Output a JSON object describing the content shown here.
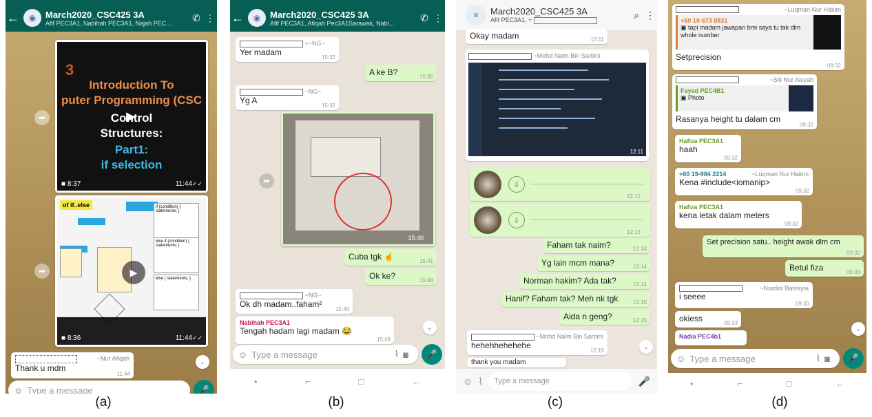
{
  "captions": [
    "(a)",
    "(b)",
    "(c)",
    "(d)"
  ],
  "panel_a": {
    "header": {
      "name": "March2020_CSC425 3A",
      "participants": "Afif PEC3A1, Nabihah PEC3A1, Najah PEC..."
    },
    "video1": {
      "slide_num": "3",
      "line1": "Introduction To",
      "line2": "puter Programming (CSC",
      "line3": "Control",
      "line4": "Structures:",
      "line5": "Part1:",
      "line6": "if selection",
      "duration": "8:37",
      "time": "11:44"
    },
    "video2": {
      "tag": "of if..else",
      "box1": "if (condition) { statements; }",
      "box2": "else if (condition) { statements; }",
      "box3": "else { statements; }",
      "duration": "8:36",
      "time": "11:44"
    },
    "msg": {
      "sender": "~Nur Afiqah",
      "text": "Thank u mdm",
      "time": "11:44"
    },
    "input_placeholder": "Type a message"
  },
  "panel_b": {
    "header": {
      "name": "March2020_CSC425 3A",
      "participants": "Afif PEC3A1, Afiqah Pec3A1Sarawak, Nabi..."
    },
    "messages": [
      {
        "sender": "+~NG~",
        "text": "Yer madam",
        "time": "15:32",
        "out": false
      },
      {
        "text": "A ke B?",
        "time": "15:32",
        "out": true
      },
      {
        "sender": "~NG~",
        "text": "Yg A",
        "time": "15:32",
        "out": false
      },
      {
        "text": "Cuba tgk",
        "time": "15:41",
        "out": true
      },
      {
        "text": "Ok ke?",
        "time": "15:48",
        "out": true
      },
      {
        "sender": "~NG~",
        "text": "Ok dh madam..faham²",
        "time": "15:49",
        "out": false
      },
      {
        "sender": "Nabihah PEC3A1",
        "text": "Tengah hadam lagi madam",
        "time": "15:49",
        "out": false
      }
    ],
    "image_time": "15:40",
    "input_placeholder": "Type a message"
  },
  "panel_c": {
    "header": {
      "name": "March2020_CSC425 3A",
      "participants": "Afif PEC3A1, +"
    },
    "messages": [
      {
        "text": "Okay madam",
        "time": "12:11",
        "out": false
      },
      {
        "sender": "~Mohd Naim Bin Sarbini",
        "time": "12:11",
        "out": false
      },
      {
        "text": "Faham tak naim?",
        "time": "12:14",
        "out": true
      },
      {
        "text": "Yg lain mcm mana?",
        "time": "12:14",
        "out": true
      },
      {
        "text": "Norman hakim? Ada tak?",
        "time": "12:14",
        "out": true
      },
      {
        "text": "Hanif? Faham tak? Meh nk tgk",
        "time": "12:15",
        "out": true
      },
      {
        "text": "Aida n geng?",
        "time": "12:15",
        "out": true
      },
      {
        "sender": "~Mohd Naim Bin Sarbini",
        "text": "hehehhehehehe",
        "time": "12:15",
        "out": false
      },
      {
        "text": "thank you madam",
        "time": "",
        "out": false
      }
    ],
    "voice_times": [
      "12:12",
      "12:13"
    ],
    "input_placeholder": "Type a message"
  },
  "panel_d": {
    "messages": [
      {
        "sender": "~Luqman Nur Hakim",
        "reply_to": "+60 19-673 8831",
        "reply_text": "tapi madam jawapan bmi saya tu tak dlm whole number",
        "text": "Setprecision",
        "time": "09:32"
      },
      {
        "sender": "~Siti Nur Aisyah",
        "reply_to": "Fayed PEC4B1",
        "reply_text": "Photo",
        "text": "Rasanya height tu dalam cm",
        "time": "09:32"
      },
      {
        "sender": "Hafiza PEC3A1",
        "text": "haah",
        "time": "09:32"
      },
      {
        "sender": "+60 19-984 2214",
        "sender_alt": "~Luqman Nur Hakim",
        "text": "Kena #include<iomanip>",
        "time": "09:32"
      },
      {
        "sender": "Hafiza PEC3A1",
        "text": "kena letak dalam meters",
        "time": "09:32"
      },
      {
        "text": "Set precision satu.. height awak dlm cm",
        "time": "09:32",
        "out": true
      },
      {
        "text": "Betul fiza",
        "time": "09:33",
        "out": true
      },
      {
        "sender": "~Nurdini Batrisyia",
        "text": "i seeee",
        "time": "09:33"
      },
      {
        "text": "okiess",
        "time": "09:33"
      },
      {
        "sender": "Nadia PEC4b1",
        "text": ""
      }
    ],
    "input_placeholder": "Type a message"
  }
}
